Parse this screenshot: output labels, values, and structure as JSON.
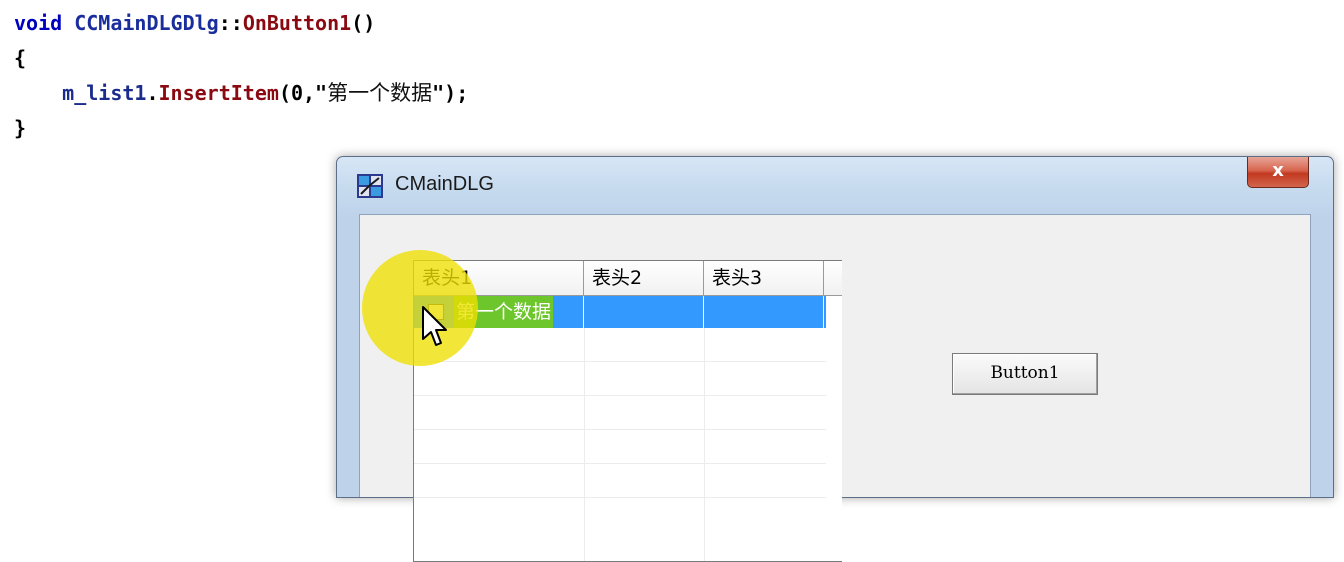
{
  "code": {
    "line1": {
      "kw": "void",
      "cls": "CCMainDLGDlg",
      "sep": "::",
      "fn": "OnButton1",
      "tail": "()"
    },
    "line2": "{",
    "line3": {
      "var": "m_list1",
      "dot": ".",
      "fn": "InsertItem",
      "args_a": "(0,\"",
      "args_cn": "第一个数据",
      "args_b": "\");"
    },
    "line4": "}"
  },
  "window": {
    "title": "CMainDLG",
    "close_label": "x"
  },
  "list": {
    "columns": [
      "表头1",
      "表头2",
      "表头3"
    ],
    "selected_row": {
      "col1": "第一个数据",
      "col2": "",
      "col3": ""
    }
  },
  "button1": {
    "label": "Button1"
  },
  "colors": {
    "selection": "#3399ff",
    "highlight": "#eee000",
    "keyword": "#0000c0",
    "function": "#8b0a12"
  },
  "icons": [
    "app-icon",
    "close-icon",
    "cursor-icon",
    "checkbox"
  ]
}
